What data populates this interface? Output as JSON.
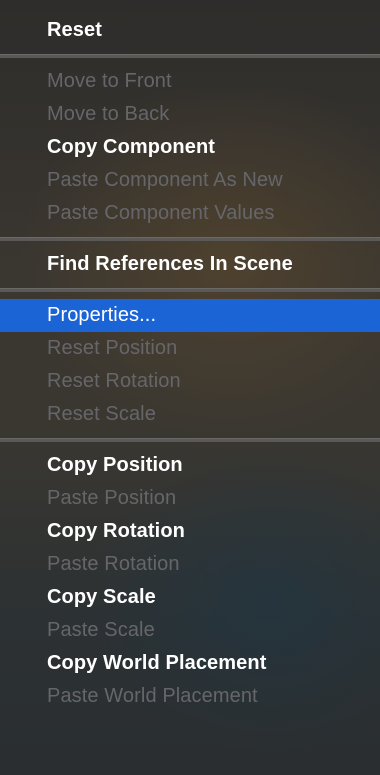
{
  "menu": {
    "reset": "Reset",
    "move_to_front": "Move to Front",
    "move_to_back": "Move to Back",
    "copy_component": "Copy Component",
    "paste_component_as_new": "Paste Component As New",
    "paste_component_values": "Paste Component Values",
    "find_references_in_scene": "Find References In Scene",
    "properties": "Properties...",
    "reset_position": "Reset Position",
    "reset_rotation": "Reset Rotation",
    "reset_scale": "Reset Scale",
    "copy_position": "Copy Position",
    "paste_position": "Paste Position",
    "copy_rotation": "Copy Rotation",
    "paste_rotation": "Paste Rotation",
    "copy_scale": "Copy Scale",
    "paste_scale": "Paste Scale",
    "copy_world_placement": "Copy World Placement",
    "paste_world_placement": "Paste World Placement"
  },
  "colors": {
    "highlight": "#1b64d6",
    "enabled_text": "#ffffff",
    "disabled_text": "#66666a"
  }
}
